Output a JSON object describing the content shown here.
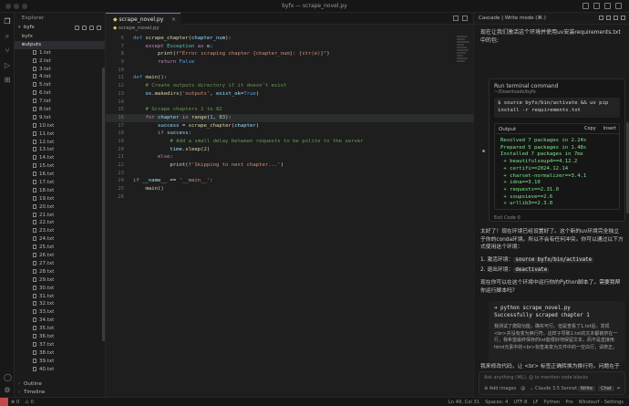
{
  "window": {
    "title": "byfx — scrape_novel.py"
  },
  "explorer": {
    "header": "Explorer",
    "root": "byfx",
    "folders": [
      "byfx",
      "outputs"
    ],
    "files": [
      "1.txt",
      "2.txt",
      "3.txt",
      "4.txt",
      "5.txt",
      "6.txt",
      "7.txt",
      "8.txt",
      "9.txt",
      "10.txt",
      "11.txt",
      "12.txt",
      "13.txt",
      "14.txt",
      "15.txt",
      "16.txt",
      "17.txt",
      "18.txt",
      "19.txt",
      "20.txt",
      "21.txt",
      "22.txt",
      "23.txt",
      "24.txt",
      "25.txt",
      "26.txt",
      "27.txt",
      "28.txt",
      "29.txt",
      "30.txt",
      "31.txt",
      "32.txt",
      "33.txt",
      "34.txt",
      "35.txt",
      "36.txt",
      "37.txt",
      "38.txt",
      "39.txt",
      "40.txt"
    ],
    "outline": "Outline",
    "timeline": "Timeline"
  },
  "editor": {
    "tab": "scrape_novel.py",
    "breadcrumb": "scrape_novel.py",
    "line_numbers": [
      "6",
      "7",
      "8",
      "9",
      "10",
      "11",
      "12",
      "13",
      "14",
      "15",
      "16",
      "17",
      "18",
      "19",
      "20",
      "21",
      "22",
      "23",
      "24",
      "25",
      "26",
      "27",
      "28",
      "29",
      "30"
    ]
  },
  "cascade": {
    "header": "Cascade | Write mode (⌘.)",
    "question": "现在让我们激活这个环境并使用uv安装requirements.txt中的包:",
    "terminal_title": "Run terminal command",
    "terminal_path": "~/Downloads/byfx",
    "command": "$ source byfx/bin/activate && uv pip install -r requirements.txt",
    "output_label": "Output",
    "copy_label": "Copy",
    "insert_label": "Insert",
    "output_lines": [
      "Resolved 7 packages in 2.24s",
      "Prepared 5 packages in 1.48s",
      "Installed 7 packages in 7ms",
      " + beautifulsoup4==4.12.2",
      " + certifi==2024.12.14",
      " + charset-normalizer==3.4.1",
      " + idna==3.10",
      " + requests==2.31.0",
      " + soupsieve==2.6",
      " + urllib3==2.3.0"
    ],
    "exit_code": "Exit Code 0",
    "para1": "太好了！现在环境已经设置好了。这个新的uv环境完全独立于你的conda环境。所以不会有任何冲突。你可以通过以下方式使用这个环境：",
    "step1_text": "激活环境：",
    "step1_code": "source byfx/bin/activate",
    "step2_text": "退出环境：",
    "step2_code": "deactivate",
    "para2": "现在你可以在这个环境中运行你的Python脚本了。需要我帮你运行脚本吗？",
    "py_cmd": "➜ python scrape_novel.py",
    "py_out": "Successfully scraped chapter 1",
    "py_note": "我测试了爬取功能，确实可行。但是查看了1.txt后，发现<br>并没有变为换行符。这样子导致1.txt的文本都被挤在一行，我希望最终保存的txt能很好地保留文本。而不是直接用html元素中的<br>标签来变为文件中的一空白行，请修正。",
    "para3": "我来修改代码，让 <br> 标签正确转换为换行符。问题在于我们需要在替换 <br> 标签的同时保留文本的格式，并且在获取文本之前进行替换。让我修改代码：",
    "input_placeholder": "Ask anything (⌘L), @ to mention code blocks",
    "add_images": "Add images",
    "model": "Claude 3.5 Sonnet",
    "write_label": "Write",
    "chat_label": "Chat"
  },
  "status": {
    "left": [
      "⊗ 0",
      "⚠ 0"
    ],
    "right": [
      "Ln 49, Col 31",
      "Spaces: 4",
      "UTF-8",
      "LF",
      "Python",
      "Pro",
      "Windsurf - Settings"
    ]
  }
}
